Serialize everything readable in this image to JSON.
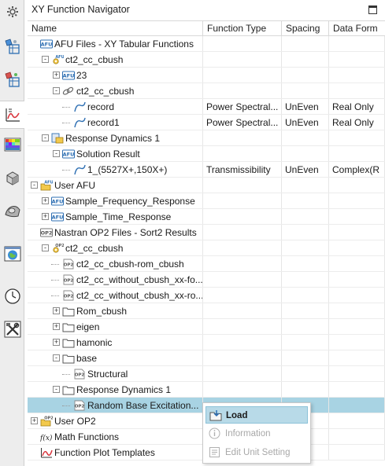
{
  "panel": {
    "title": "XY Function Navigator"
  },
  "columns": [
    "Name",
    "Function Type",
    "Spacing",
    "Data Form"
  ],
  "rows": [
    {
      "name": "AFU Files - XY Tabular Functions",
      "type": "",
      "spacing": "",
      "form": ""
    },
    {
      "name": "ct2_cc_cbush",
      "type": "",
      "spacing": "",
      "form": ""
    },
    {
      "name": "23",
      "type": "",
      "spacing": "",
      "form": ""
    },
    {
      "name": "ct2_cc_cbush",
      "type": "",
      "spacing": "",
      "form": ""
    },
    {
      "name": "record",
      "type": "Power Spectral...",
      "spacing": "UnEven",
      "form": "Real Only"
    },
    {
      "name": "record1",
      "type": "Power Spectral...",
      "spacing": "UnEven",
      "form": "Real Only"
    },
    {
      "name": "Response Dynamics 1",
      "type": "",
      "spacing": "",
      "form": ""
    },
    {
      "name": "Solution Result",
      "type": "",
      "spacing": "",
      "form": ""
    },
    {
      "name": "1_(5527X+,150X+)",
      "type": "Transmissibility",
      "spacing": "UnEven",
      "form": "Complex(R"
    },
    {
      "name": "User AFU",
      "type": "",
      "spacing": "",
      "form": ""
    },
    {
      "name": "Sample_Frequency_Response",
      "type": "",
      "spacing": "",
      "form": ""
    },
    {
      "name": "Sample_Time_Response",
      "type": "",
      "spacing": "",
      "form": ""
    },
    {
      "name": "Nastran OP2 Files - Sort2 Results",
      "type": "",
      "spacing": "",
      "form": ""
    },
    {
      "name": "ct2_cc_cbush",
      "type": "",
      "spacing": "",
      "form": ""
    },
    {
      "name": "ct2_cc_cbush-rom_cbush",
      "type": "",
      "spacing": "",
      "form": ""
    },
    {
      "name": "ct2_cc_without_cbush_xx-fo...",
      "type": "",
      "spacing": "",
      "form": ""
    },
    {
      "name": "ct2_cc_without_cbush_xx-ro...",
      "type": "",
      "spacing": "",
      "form": ""
    },
    {
      "name": "Rom_cbush",
      "type": "",
      "spacing": "",
      "form": ""
    },
    {
      "name": "eigen",
      "type": "",
      "spacing": "",
      "form": ""
    },
    {
      "name": "hamonic",
      "type": "",
      "spacing": "",
      "form": ""
    },
    {
      "name": "base",
      "type": "",
      "spacing": "",
      "form": ""
    },
    {
      "name": "Structural",
      "type": "",
      "spacing": "",
      "form": ""
    },
    {
      "name": "Response Dynamics 1",
      "type": "",
      "spacing": "",
      "form": ""
    },
    {
      "name": "Random Base Excitation...",
      "type": "",
      "spacing": "",
      "form": ""
    },
    {
      "name": "User OP2",
      "type": "",
      "spacing": "",
      "form": ""
    },
    {
      "name": "Math Functions",
      "type": "",
      "spacing": "",
      "form": ""
    },
    {
      "name": "Function Plot Templates",
      "type": "",
      "spacing": "",
      "form": ""
    }
  ],
  "badges": {
    "afu": "AFU",
    "op2": "OP2",
    "math": "f(x)"
  },
  "context_menu": [
    {
      "label": "Load",
      "enabled": true,
      "highlighted": true,
      "icon": "load-folder-icon"
    },
    {
      "label": "Information",
      "enabled": false,
      "icon": "info-icon"
    },
    {
      "label": "Edit Unit Setting",
      "enabled": false,
      "icon": "edit-unit-icon"
    }
  ],
  "colors": {
    "selection": "#a8d3e3",
    "accent": "#3a7fc1",
    "folder": "#f2c94c"
  }
}
